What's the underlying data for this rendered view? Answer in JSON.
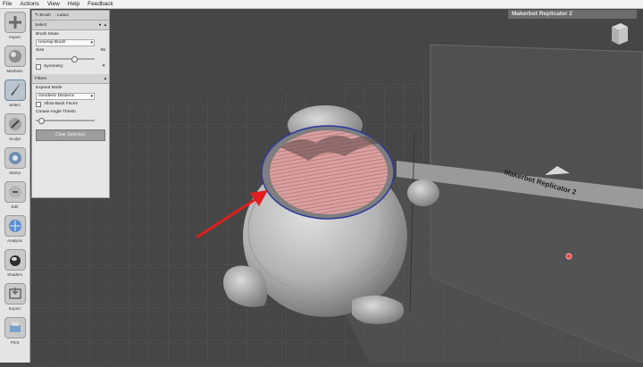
{
  "menu": [
    "File",
    "Actions",
    "View",
    "Help",
    "Feedback"
  ],
  "tools": [
    {
      "label": "Import",
      "icon": "plus-icon"
    },
    {
      "label": "Meshmix",
      "icon": "meshmix-icon"
    },
    {
      "label": "Select",
      "icon": "cursor-icon"
    },
    {
      "label": "Sculpt",
      "icon": "brush-icon"
    },
    {
      "label": "Stamp",
      "icon": "stamp-icon"
    },
    {
      "label": "Edit",
      "icon": "edit-icon"
    },
    {
      "label": "Analysis",
      "icon": "analysis-icon"
    },
    {
      "label": "Shaders",
      "icon": "shaders-icon"
    },
    {
      "label": "Export",
      "icon": "export-icon"
    },
    {
      "label": "Print",
      "icon": "print-icon"
    }
  ],
  "panel": {
    "tabs": [
      "Brush",
      "Lasso"
    ],
    "select": {
      "title": "Select",
      "brush_mode_label": "Brush Mode",
      "brush_mode_value": "Unwrap Brush",
      "size_label": "Size",
      "size_value": "55",
      "size_fraction": 0.6,
      "symmetry_label": "Symmetry"
    },
    "filters": {
      "title": "Filters",
      "expand_mode_label": "Expand Mode",
      "expand_mode_value": "Geodesic Distance",
      "back_faces_label": "Allow Back Faces",
      "crease_label": "Crease Angle Thresh",
      "crease_fraction": 0.05
    },
    "clear_button": "Clear Selection"
  },
  "machine_title": "Makerbot Replicator 2",
  "bed_label": "Makerbot Replicator 2",
  "colors": {
    "selection": "#d79a9a",
    "arrow": "#e41d1d",
    "selection_outline": "#2a3aa0",
    "viewport_bg": "#4a4a4a"
  }
}
